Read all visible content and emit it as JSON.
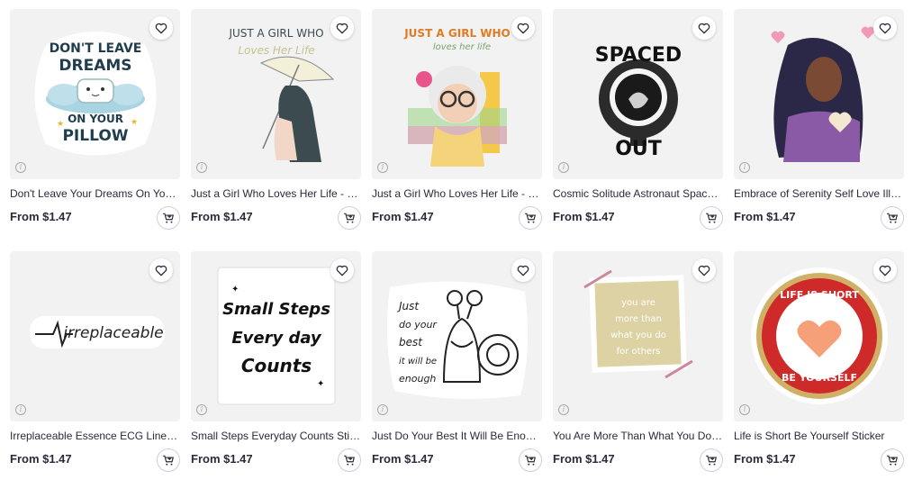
{
  "products": [
    {
      "title": "Don't Leave Your Dreams On Your Pillow Sticker",
      "price": "From $1.47",
      "art": {
        "lines": [
          "DON'T LEAVE",
          "DREAMS",
          "ON YOUR",
          "PILLOW"
        ]
      }
    },
    {
      "title": "Just a Girl Who Loves Her Life - Pastel Sticker",
      "price": "From $1.47",
      "art": {
        "lines": [
          "JUST A GIRL WHO",
          "Loves Her Life"
        ]
      }
    },
    {
      "title": "Just a Girl Who Loves Her Life - Whimsical Sticker",
      "price": "From $1.47",
      "art": {
        "lines": [
          "JUST A GIRL WHO",
          "loves her life"
        ]
      }
    },
    {
      "title": "Cosmic Solitude Astronaut Space Sticker",
      "price": "From $1.47",
      "art": {
        "lines": [
          "SPACED",
          "OUT"
        ]
      }
    },
    {
      "title": "Embrace of Serenity Self Love Illustration Sticker",
      "price": "From $1.47",
      "art": {
        "lines": []
      }
    },
    {
      "title": "Irreplaceable Essence ECG Line Sticker",
      "price": "From $1.47",
      "art": {
        "lines": [
          "irreplaceable"
        ]
      }
    },
    {
      "title": "Small Steps Everyday Counts Sticker",
      "price": "From $1.47",
      "art": {
        "lines": [
          "Small Steps",
          "Every day",
          "Counts"
        ]
      }
    },
    {
      "title": "Just Do Your Best It Will Be Enough Sticker",
      "price": "From $1.47",
      "art": {
        "lines": [
          "Just",
          "do your",
          "best",
          "it will be",
          "enough"
        ]
      }
    },
    {
      "title": "You Are More Than What You Do For Others Sticker",
      "price": "From $1.47",
      "art": {
        "lines": [
          "you are",
          "more than",
          "what you do",
          "for others"
        ]
      }
    },
    {
      "title": "Life is Short Be Yourself Sticker",
      "price": "From $1.47",
      "art": {
        "lines": [
          "LIFE IS SHORT",
          "BE YOURSELF"
        ]
      }
    }
  ],
  "icons": {
    "favorite": "heart-icon",
    "cart": "add-to-cart-icon",
    "info": "info-icon"
  },
  "colors": {
    "text": "#2a2a3a",
    "thumb_bg": "#f2f2f2"
  }
}
